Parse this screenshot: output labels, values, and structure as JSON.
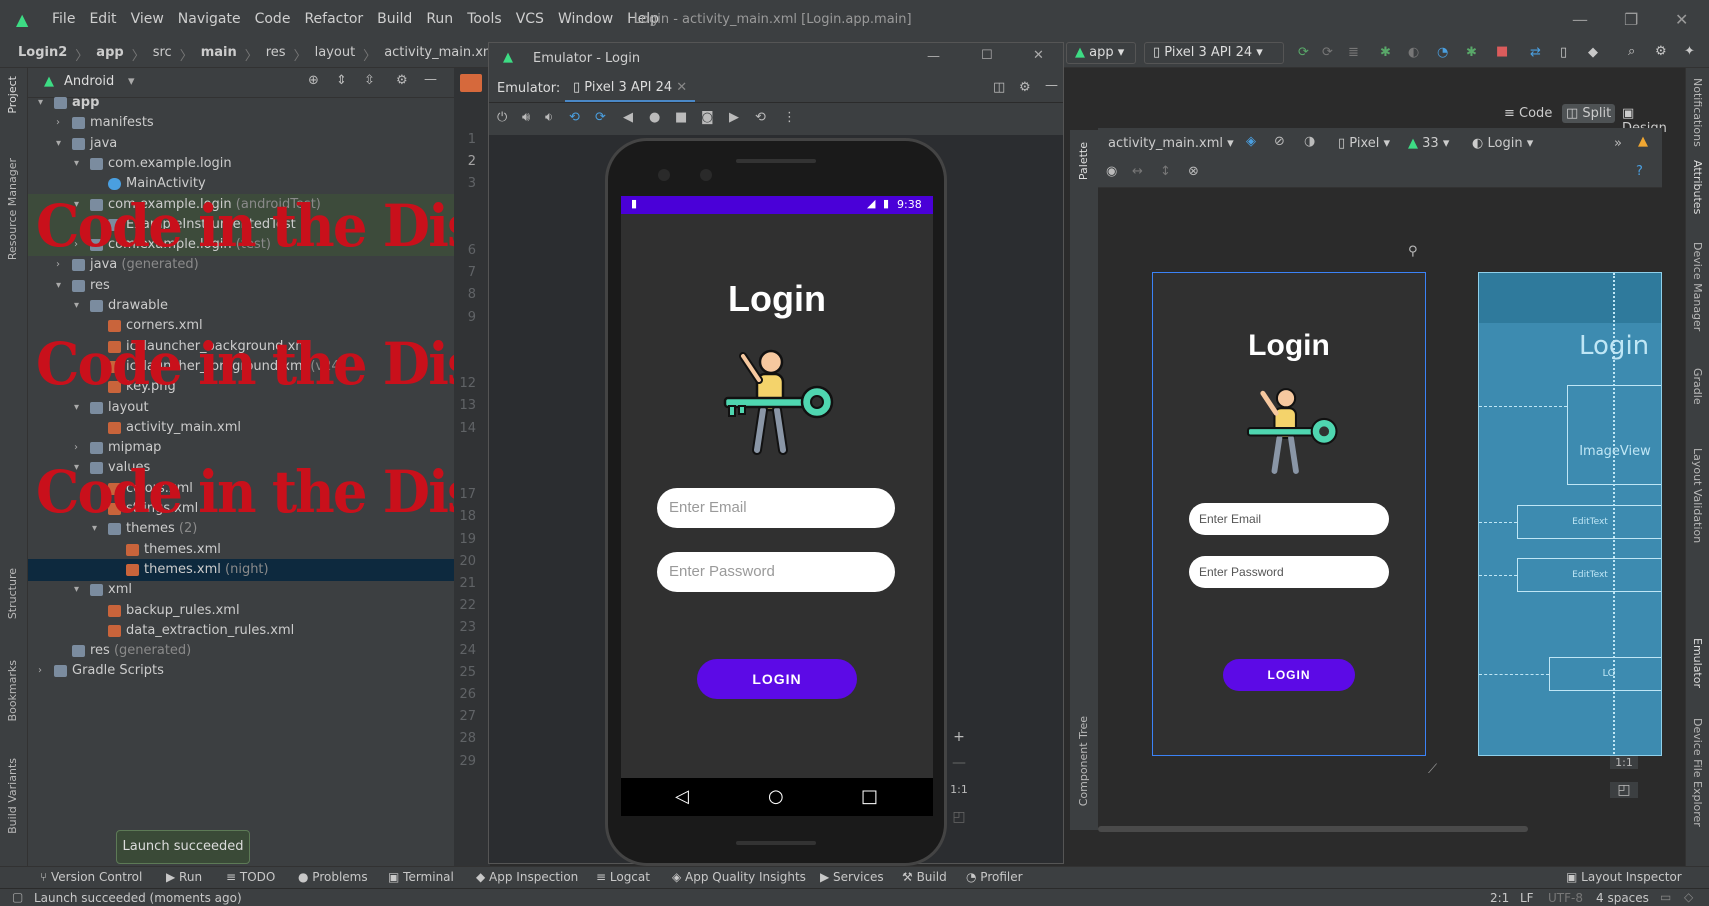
{
  "window": {
    "title": "Login - activity_main.xml [Login.app.main]",
    "menu": [
      "File",
      "Edit",
      "View",
      "Navigate",
      "Code",
      "Refactor",
      "Build",
      "Run",
      "Tools",
      "VCS",
      "Window",
      "Help"
    ]
  },
  "breadcrumb": [
    "Login2",
    "app",
    "src",
    "main",
    "res",
    "layout",
    "activity_main.xml"
  ],
  "toolbar": {
    "run_config": "app",
    "device": "Pixel 3 API 24"
  },
  "project": {
    "view_label": "Android",
    "tree": [
      {
        "label": "app",
        "muted": ""
      },
      {
        "label": "manifests",
        "muted": ""
      },
      {
        "label": "java",
        "muted": ""
      },
      {
        "label": "com.example.login",
        "muted": ""
      },
      {
        "label": "MainActivity",
        "muted": ""
      },
      {
        "label": "com.example.login",
        "muted": "(androidTest)"
      },
      {
        "label": "ExampleInstrumentedTest",
        "muted": ""
      },
      {
        "label": "com.example.login",
        "muted": "(test)"
      },
      {
        "label": "java",
        "muted": "(generated)"
      },
      {
        "label": "res",
        "muted": ""
      },
      {
        "label": "drawable",
        "muted": ""
      },
      {
        "label": "corners.xml",
        "muted": ""
      },
      {
        "label": "ic_launcher_background.xml",
        "muted": ""
      },
      {
        "label": "ic_launcher_foreground.xml",
        "muted": "(v24)"
      },
      {
        "label": "key.png",
        "muted": ""
      },
      {
        "label": "layout",
        "muted": ""
      },
      {
        "label": "activity_main.xml",
        "muted": ""
      },
      {
        "label": "mipmap",
        "muted": ""
      },
      {
        "label": "values",
        "muted": ""
      },
      {
        "label": "colors.xml",
        "muted": ""
      },
      {
        "label": "strings.xml",
        "muted": ""
      },
      {
        "label": "themes",
        "muted": "(2)"
      },
      {
        "label": "themes.xml",
        "muted": ""
      },
      {
        "label": "themes.xml",
        "muted": "(night)"
      },
      {
        "label": "xml",
        "muted": ""
      },
      {
        "label": "backup_rules.xml",
        "muted": ""
      },
      {
        "label": "data_extraction_rules.xml",
        "muted": ""
      },
      {
        "label": "res",
        "muted": "(generated)"
      },
      {
        "label": "Gradle Scripts",
        "muted": ""
      }
    ]
  },
  "watermark": "Code  in the Discription",
  "line_numbers": [
    "1",
    "2",
    "3",
    "",
    "",
    "6",
    "7",
    "8",
    "9",
    "",
    "",
    "12",
    "13",
    "14",
    "",
    "",
    "17",
    "18",
    "19",
    "20",
    "21",
    "22",
    "23",
    "24",
    "25",
    "26",
    "27",
    "28",
    "29"
  ],
  "emulator": {
    "window_title": "Emulator - Login",
    "label": "Emulator:",
    "tab": "Pixel 3 API 24",
    "clock": "9:38",
    "app": {
      "title": "Login",
      "email_placeholder": "Enter Email",
      "password_placeholder": "Enter Password",
      "button": "LOGIN"
    },
    "zoom_ratio": "1:1"
  },
  "design": {
    "view_modes": [
      "Code",
      "Split",
      "Design"
    ],
    "file": "activity_main.xml",
    "device": "Pixel",
    "api": "33",
    "theme": "Login",
    "preview": {
      "title": "Login",
      "email_placeholder": "Enter Email",
      "password_placeholder": "Enter Password",
      "button": "LOGIN"
    },
    "blueprint": {
      "title": "Login",
      "image": "ImageView",
      "edit1": "EditText",
      "edit2": "EditText",
      "button": "LO"
    },
    "zoom_ratio": "1:1",
    "palette_label": "Palette",
    "component_tree_label": "Component Tree"
  },
  "left_strip": [
    "Project",
    "Resource Manager",
    "Structure",
    "Bookmarks",
    "Build Variants"
  ],
  "right_strip": [
    "Notifications",
    "Attributes",
    "Device Manager",
    "Gradle",
    "Layout Validation",
    "Emulator",
    "Device File Explorer"
  ],
  "bottom_tools": [
    "Version Control",
    "Run",
    "TODO",
    "Problems",
    "Terminal",
    "App Inspection",
    "Logcat",
    "App Quality Insights",
    "Services",
    "Build",
    "Profiler"
  ],
  "layout_inspector": "Layout Inspector",
  "toast": "Launch succeeded",
  "status": {
    "message": "Launch succeeded (moments ago)",
    "position": "2:1",
    "line_sep": "LF",
    "encoding": "UTF-8",
    "indent": "4 spaces"
  }
}
